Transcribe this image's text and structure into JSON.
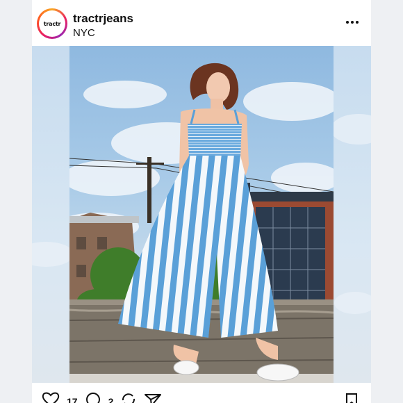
{
  "post": {
    "username": "tractrjeans",
    "location": "NYC",
    "avatar_text": "tractr",
    "likes_count": "17",
    "comments_count": "2"
  },
  "icons": {
    "more": "more-horizontal-icon",
    "like": "heart-icon",
    "comment": "comment-icon",
    "share": "send-icon",
    "save": "bookmark-icon"
  },
  "colors": {
    "background": "#eef0f3",
    "card": "#ffffff",
    "sky": "#8fb9e0",
    "jumpsuit_stripe": "#5aa0d8",
    "text": "#111111"
  }
}
